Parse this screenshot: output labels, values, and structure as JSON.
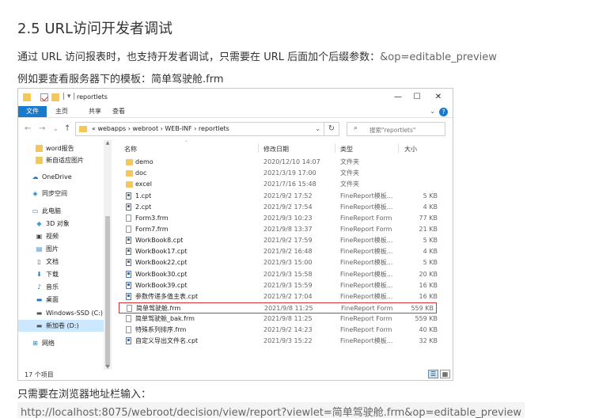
{
  "doc": {
    "heading": "2.5 URL访问开发者调试",
    "para1_text": "通过 URL 访问报表时，也支持开发者调试，只需要在 URL 后面加个后缀参数：",
    "para1_code": "&op=editable_preview",
    "para2": "例如要查看服务器下的模板：简单驾驶舱.frm",
    "para3": "只需要在浏览器地址栏输入：",
    "url": "http://localhost:8075/webroot/decision/view/report?viewlet=简单驾驶舱.frm&op=editable_preview"
  },
  "explorer": {
    "title": "reportlets",
    "quick_access_sep": "| ▾ |",
    "window_buttons": {
      "minimize": "—",
      "maximize": "☐",
      "close": "✕"
    },
    "ribbon_tabs": [
      "文件",
      "主页",
      "共享",
      "查看"
    ],
    "help": "?",
    "nav": {
      "back": "←",
      "forward": "→",
      "down": "⌄",
      "up": "↑"
    },
    "address_path": "«  webapps  ›  webroot  ›  WEB-INF  ›  reportlets",
    "address_dropdown": "⌄",
    "refresh": "↻",
    "search_placeholder": "搜索\"reportlets\"",
    "sidebar": [
      {
        "label": "word报告",
        "icon": "folder-icon"
      },
      {
        "label": "新自适应图片",
        "icon": "folder-icon"
      },
      {
        "label": "OneDrive",
        "icon": "cloud-icon"
      },
      {
        "label": "同步空间",
        "icon": "sync-icon"
      },
      {
        "label": "此电脑",
        "icon": "computer-icon"
      },
      {
        "label": "3D 对象",
        "icon": "cube-icon"
      },
      {
        "label": "视频",
        "icon": "video-icon"
      },
      {
        "label": "图片",
        "icon": "image-icon"
      },
      {
        "label": "文档",
        "icon": "document-icon"
      },
      {
        "label": "下载",
        "icon": "download-icon"
      },
      {
        "label": "音乐",
        "icon": "music-icon"
      },
      {
        "label": "桌面",
        "icon": "desktop-icon"
      },
      {
        "label": "Windows-SSD (C:)",
        "icon": "drive-icon"
      },
      {
        "label": "新加卷 (D:)",
        "icon": "drive-icon"
      },
      {
        "label": "网络",
        "icon": "network-icon"
      }
    ],
    "columns": [
      "名称",
      "修改日期",
      "类型",
      "大小"
    ],
    "files": [
      {
        "name": "demo",
        "date": "2020/12/10 14:07",
        "type": "文件夹",
        "size": "",
        "kind": "folder"
      },
      {
        "name": "doc",
        "date": "2021/3/19 17:00",
        "type": "文件夹",
        "size": "",
        "kind": "folder"
      },
      {
        "name": "excel",
        "date": "2021/7/16 15:48",
        "type": "文件夹",
        "size": "",
        "kind": "folder"
      },
      {
        "name": "1.cpt",
        "date": "2021/9/2 17:52",
        "type": "FineReport模板...",
        "size": "5 KB",
        "kind": "cpt"
      },
      {
        "name": "2.cpt",
        "date": "2021/9/2 17:54",
        "type": "FineReport模板...",
        "size": "4 KB",
        "kind": "cpt"
      },
      {
        "name": "Form3.frm",
        "date": "2021/9/3 10:23",
        "type": "FineReport Form",
        "size": "77 KB",
        "kind": "frm"
      },
      {
        "name": "Form7.frm",
        "date": "2021/9/8 13:37",
        "type": "FineReport Form",
        "size": "21 KB",
        "kind": "frm"
      },
      {
        "name": "WorkBook8.cpt",
        "date": "2021/9/2 17:59",
        "type": "FineReport模板...",
        "size": "5 KB",
        "kind": "cpt"
      },
      {
        "name": "WorkBook17.cpt",
        "date": "2021/9/2 16:48",
        "type": "FineReport模板...",
        "size": "4 KB",
        "kind": "cpt"
      },
      {
        "name": "WorkBook22.cpt",
        "date": "2021/9/3 15:00",
        "type": "FineReport模板...",
        "size": "5 KB",
        "kind": "cpt"
      },
      {
        "name": "WorkBook30.cpt",
        "date": "2021/9/3 15:58",
        "type": "FineReport模板...",
        "size": "20 KB",
        "kind": "cpt"
      },
      {
        "name": "WorkBook39.cpt",
        "date": "2021/9/3 15:59",
        "type": "FineReport模板...",
        "size": "16 KB",
        "kind": "cpt"
      },
      {
        "name": "参数传递多值主表.cpt",
        "date": "2021/9/2 17:04",
        "type": "FineReport模板...",
        "size": "16 KB",
        "kind": "cpt"
      },
      {
        "name": "简单驾驶舱.frm",
        "date": "2021/9/8 11:25",
        "type": "FineReport Form",
        "size": "559 KB",
        "kind": "frm",
        "highlight": true
      },
      {
        "name": "简单驾驶舱_bak.frm",
        "date": "2021/9/8 11:25",
        "type": "FineReport Form",
        "size": "559 KB",
        "kind": "frm"
      },
      {
        "name": "特殊系列排序.frm",
        "date": "2021/9/2 14:23",
        "type": "FineReport Form",
        "size": "40 KB",
        "kind": "frm"
      },
      {
        "name": "自定义导出文件名.cpt",
        "date": "2021/9/3 15:22",
        "type": "FineReport模板...",
        "size": "32 KB",
        "kind": "cpt"
      }
    ],
    "status": "17 个项目",
    "view_buttons": [
      "☰",
      "▦"
    ],
    "colors": {
      "accent": "#1979ca",
      "selection": "#cce8ff",
      "highlight_border": "#dd3333",
      "folder": "#f3c75a"
    }
  }
}
